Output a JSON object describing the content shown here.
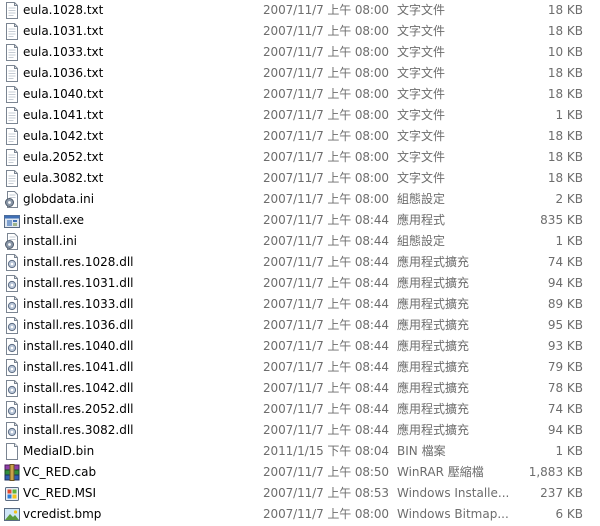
{
  "files": [
    {
      "name": "eula.1028.txt",
      "modified": "2007/11/7 上午 08:00",
      "type": "文字文件",
      "size": "18 KB",
      "icon": "text-file-icon"
    },
    {
      "name": "eula.1031.txt",
      "modified": "2007/11/7 上午 08:00",
      "type": "文字文件",
      "size": "18 KB",
      "icon": "text-file-icon"
    },
    {
      "name": "eula.1033.txt",
      "modified": "2007/11/7 上午 08:00",
      "type": "文字文件",
      "size": "10 KB",
      "icon": "text-file-icon"
    },
    {
      "name": "eula.1036.txt",
      "modified": "2007/11/7 上午 08:00",
      "type": "文字文件",
      "size": "18 KB",
      "icon": "text-file-icon"
    },
    {
      "name": "eula.1040.txt",
      "modified": "2007/11/7 上午 08:00",
      "type": "文字文件",
      "size": "18 KB",
      "icon": "text-file-icon"
    },
    {
      "name": "eula.1041.txt",
      "modified": "2007/11/7 上午 08:00",
      "type": "文字文件",
      "size": "1 KB",
      "icon": "text-file-icon"
    },
    {
      "name": "eula.1042.txt",
      "modified": "2007/11/7 上午 08:00",
      "type": "文字文件",
      "size": "18 KB",
      "icon": "text-file-icon"
    },
    {
      "name": "eula.2052.txt",
      "modified": "2007/11/7 上午 08:00",
      "type": "文字文件",
      "size": "18 KB",
      "icon": "text-file-icon"
    },
    {
      "name": "eula.3082.txt",
      "modified": "2007/11/7 上午 08:00",
      "type": "文字文件",
      "size": "18 KB",
      "icon": "text-file-icon"
    },
    {
      "name": "globdata.ini",
      "modified": "2007/11/7 上午 08:00",
      "type": "組態設定",
      "size": "2 KB",
      "icon": "settings-file-icon"
    },
    {
      "name": "install.exe",
      "modified": "2007/11/7 上午 08:44",
      "type": "應用程式",
      "size": "835 KB",
      "icon": "application-icon"
    },
    {
      "name": "install.ini",
      "modified": "2007/11/7 上午 08:44",
      "type": "組態設定",
      "size": "1 KB",
      "icon": "settings-file-icon"
    },
    {
      "name": "install.res.1028.dll",
      "modified": "2007/11/7 上午 08:44",
      "type": "應用程式擴充",
      "size": "74 KB",
      "icon": "dll-file-icon"
    },
    {
      "name": "install.res.1031.dll",
      "modified": "2007/11/7 上午 08:44",
      "type": "應用程式擴充",
      "size": "94 KB",
      "icon": "dll-file-icon"
    },
    {
      "name": "install.res.1033.dll",
      "modified": "2007/11/7 上午 08:44",
      "type": "應用程式擴充",
      "size": "89 KB",
      "icon": "dll-file-icon"
    },
    {
      "name": "install.res.1036.dll",
      "modified": "2007/11/7 上午 08:44",
      "type": "應用程式擴充",
      "size": "95 KB",
      "icon": "dll-file-icon"
    },
    {
      "name": "install.res.1040.dll",
      "modified": "2007/11/7 上午 08:44",
      "type": "應用程式擴充",
      "size": "93 KB",
      "icon": "dll-file-icon"
    },
    {
      "name": "install.res.1041.dll",
      "modified": "2007/11/7 上午 08:44",
      "type": "應用程式擴充",
      "size": "79 KB",
      "icon": "dll-file-icon"
    },
    {
      "name": "install.res.1042.dll",
      "modified": "2007/11/7 上午 08:44",
      "type": "應用程式擴充",
      "size": "78 KB",
      "icon": "dll-file-icon"
    },
    {
      "name": "install.res.2052.dll",
      "modified": "2007/11/7 上午 08:44",
      "type": "應用程式擴充",
      "size": "74 KB",
      "icon": "dll-file-icon"
    },
    {
      "name": "install.res.3082.dll",
      "modified": "2007/11/7 上午 08:44",
      "type": "應用程式擴充",
      "size": "94 KB",
      "icon": "dll-file-icon"
    },
    {
      "name": "MediaID.bin",
      "modified": "2011/1/15 下午 08:04",
      "type": "BIN 檔案",
      "size": "1 KB",
      "icon": "blank-file-icon"
    },
    {
      "name": "VC_RED.cab",
      "modified": "2007/11/7 上午 08:50",
      "type": "WinRAR 壓縮檔",
      "size": "1,883 KB",
      "icon": "winrar-archive-icon"
    },
    {
      "name": "VC_RED.MSI",
      "modified": "2007/11/7 上午 08:53",
      "type": "Windows Installe...",
      "size": "237 KB",
      "icon": "windows-installer-icon"
    },
    {
      "name": "vcredist.bmp",
      "modified": "2007/11/7 上午 08:00",
      "type": "Windows Bitmap...",
      "size": "6 KB",
      "icon": "bitmap-image-icon"
    }
  ]
}
